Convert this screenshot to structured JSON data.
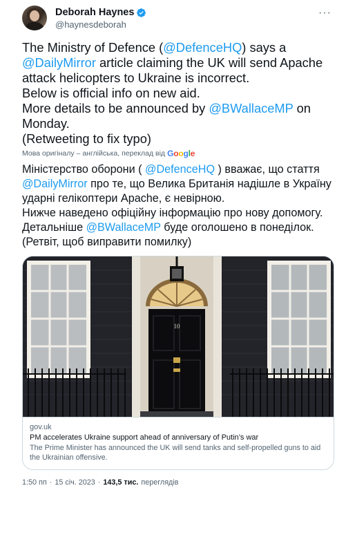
{
  "author": {
    "display_name": "Deborah Haynes",
    "handle": "@haynesdeborah",
    "verified": true,
    "avatar_icon": "avatar-photo"
  },
  "more_icon": "more-dots-icon",
  "tweet": {
    "segments": [
      {
        "text": "The Ministry of Defence (",
        "link": false
      },
      {
        "text": "@DefenceHQ",
        "link": true
      },
      {
        "text": ") says a ",
        "link": false
      },
      {
        "text": "@DailyMirror",
        "link": true
      },
      {
        "text": " article claiming the UK will send Apache attack helicopters to Ukraine is incorrect.\nBelow is official info on new aid.\nMore details to be announced by ",
        "link": false
      },
      {
        "text": "@BWallaceMP",
        "link": true
      },
      {
        "text": " on Monday.\n(Retweeting to fix typo)",
        "link": false
      }
    ]
  },
  "translation": {
    "note": "Мова оригіналу – англійська, переклад від",
    "provider": "Google",
    "segments": [
      {
        "text": "Міністерство оборони ( ",
        "link": false
      },
      {
        "text": "@DefenceHQ",
        "link": true
      },
      {
        "text": " ) вважає, що стаття ",
        "link": false
      },
      {
        "text": "@DailyMirror",
        "link": true
      },
      {
        "text": " про те, що Велика Британія надішле в Україну ударні гелікоптери Apache, є невірною.\nНижче наведено офіційну інформацію про нову допомогу.\nДетальніше ",
        "link": false
      },
      {
        "text": "@BWallaceMP",
        "link": true
      },
      {
        "text": " буде оголошено в понеділок.\n(Ретвіт, щоб виправити помилку)",
        "link": false
      }
    ]
  },
  "card": {
    "image_alt": "10 Downing Street door",
    "door_number": "10",
    "domain": "gov.uk",
    "title": "PM accelerates Ukraine support ahead of anniversary of Putin’s war",
    "description": "The Prime Minister has announced the UK will send tanks and self-propelled guns to aid the Ukrainian offensive."
  },
  "footer": {
    "time": "1:50 пп",
    "date": "15 січ. 2023",
    "views_count": "143,5 тис.",
    "views_label": "переглядів"
  },
  "colors": {
    "link": "#1d9bf0",
    "secondary_text": "#536471",
    "verified": "#1d9bf0"
  }
}
